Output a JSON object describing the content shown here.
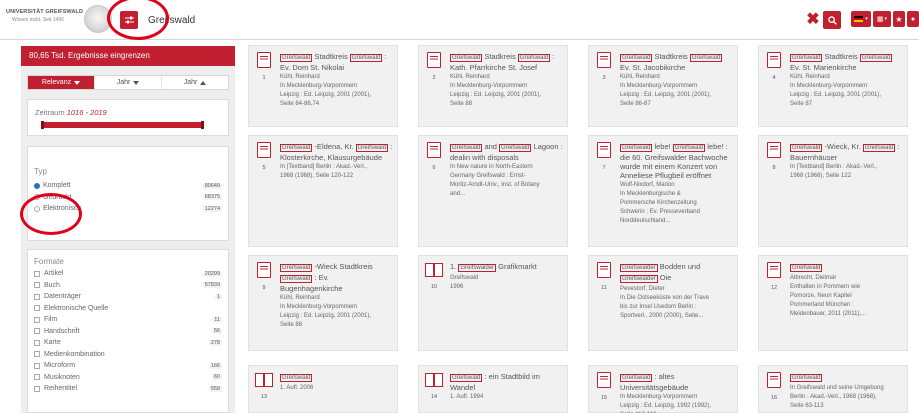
{
  "header": {
    "logo_name": "UNIVERSITÄT GREIFSWALD",
    "logo_claim": "Wissen lockt. Seit 1456",
    "search_value": "Greifswald",
    "clear_symbol": "✖",
    "buttons": {
      "filter_icon": "sliders-icon",
      "search_icon": "search-icon",
      "language_icon": "german-flag-icon",
      "apps_icon": "grid-icon",
      "favorites_icon": "star-icon",
      "account_icon": "user-icon"
    },
    "accent_color": "#c0202f"
  },
  "sidebar": {
    "results_heading": "80,65 Tsd. Ergebnisse eingrenzen",
    "sort_tabs": [
      "Relevanz",
      "Jahr",
      "Jahr"
    ],
    "zeitraum": {
      "label": "Zeitraum",
      "from": "1016",
      "to": "2019",
      "sep": " - "
    },
    "typ": {
      "title": "Typ",
      "options": [
        {
          "label": "Komplett",
          "count": "80649",
          "selected": true
        },
        {
          "label": "Gedruckt",
          "count": "68375",
          "selected": false
        },
        {
          "label": "Elektronisch",
          "count": "12274",
          "selected": false
        }
      ]
    },
    "formate": {
      "title": "Formate",
      "items": [
        {
          "label": "Artikel",
          "count": "20299"
        },
        {
          "label": "Buch",
          "count": "57839"
        },
        {
          "label": "Datenträger",
          "count": "1"
        },
        {
          "label": "Elektronische Quelle",
          "count": ""
        },
        {
          "label": "Film",
          "count": "11"
        },
        {
          "label": "Handschrift",
          "count": "56"
        },
        {
          "label": "Karte",
          "count": "278"
        },
        {
          "label": "Medienkombination",
          "count": ""
        },
        {
          "label": "Microform",
          "count": "166"
        },
        {
          "label": "Musiknoten",
          "count": "60"
        },
        {
          "label": "Reihentitel",
          "count": "559"
        }
      ]
    }
  },
  "results": [
    {
      "num": "1",
      "icon": "document",
      "title_hl": "Greifswald",
      "title": "Stadtkreis",
      "title_hl2": "Greifswald",
      "title_rest": ": Ev. Dom St. Nikolai",
      "lines": [
        "Kühl, Reinhard",
        "In Mecklenburg-Vorpommern",
        "Leipzig : Ed. Leipzig, 2001 (2001),",
        "Seite 84-86,74"
      ]
    },
    {
      "num": "2",
      "icon": "document",
      "title_hl": "Greifswald",
      "title": "Stadkreis",
      "title_hl2": "Greifswald",
      "title_rest": ": Kath. Pfarrkirche St. Josef",
      "lines": [
        "Kühl, Reinhard",
        "In Mecklenburg-Vorpommern",
        "Leipzig : Ed. Leipzig, 2001 (2001),",
        "Seite 88"
      ]
    },
    {
      "num": "3",
      "icon": "document",
      "title_hl": "Greifswald",
      "title": "Stadtkreis",
      "title_hl2": "Greifswald",
      "title_rest": "Ev. St. Jacobikirche",
      "lines": [
        "Kühl, Reinhard",
        "In Mecklenburg-Vorpommern",
        "Leipzig : Ed. Leipzig, 2001 (2001),",
        "Seite 86-87"
      ]
    },
    {
      "num": "4",
      "icon": "document",
      "title_hl": "Greifswald",
      "title": "Stadtkreis",
      "title_hl2": "Greifswald",
      "title_rest": "Ev. St. Marienkirche",
      "lines": [
        "Kühl, Reinhard",
        "In Mecklenburg-Vorpommern",
        "Leipzig : Ed. Leipzig, 2001 (2001),",
        "Seite 87"
      ]
    },
    {
      "num": "5",
      "icon": "document",
      "title_hl": "Greifswald",
      "title": "-Eldena, Kr.",
      "title_hl2": "Greifswald",
      "title_rest": ": Klosterkirche, Klausurgebäude",
      "lines": [
        "In [Textband] Berlin : Akad.-Verl.,",
        "1968 (1968), Seite 120-122"
      ]
    },
    {
      "num": "6",
      "icon": "document",
      "title_hl": "Greifswald",
      "title": "and",
      "title_hl2": "Greifswald",
      "title_rest": "Lagoon : dealin with disposals",
      "lines": [
        "In New nature in North-Eastern",
        "Germany Greifswald : Ernst-",
        "Moritz-Arndt-Univ., Inst. of Botany",
        "and..."
      ]
    },
    {
      "num": "7",
      "icon": "document",
      "title_hl": "Greifswald",
      "title": "lebe!",
      "title_hl2": "Greifswald",
      "title_rest": "lebe! : die 60. Greifswalder Bachwoche wurde mit einem Konzert von Anneliese Pflugbeil eröffnet",
      "lines": [
        "Wulf-Nixdorf, Marion",
        "In Mecklenburgische &",
        "Pommersche Kirchenzeitung",
        "Schwerin : Ev. Presseverband",
        "Norddeutschland..."
      ]
    },
    {
      "num": "8",
      "icon": "document",
      "title_hl": "Greifswald",
      "title": "-Wieck, Kr.",
      "title_hl2": "Greifswald",
      "title_rest": ": Bauernhäuser",
      "lines": [
        "In [Textband] Berlin : Akad.-Verl.,",
        "1968 (1968), Seite 122"
      ]
    },
    {
      "num": "9",
      "icon": "document",
      "title_hl": "Greifswald",
      "title": "-Wieck Stadtkreis",
      "title_hl2": "Greifswald",
      "title_rest": ": Ev. Bugenhagenkirche",
      "lines": [
        "Kühl, Reinhard",
        "In Mecklenburg-Vorpommern",
        "Leipzig : Ed. Leipzig, 2001 (2001),",
        "Seite 88"
      ]
    },
    {
      "num": "10",
      "icon": "book",
      "title_hl": "",
      "title": "1.",
      "title_hl2": "Greifswalder",
      "title_rest": "Grafikmarkt",
      "lines": [
        "Greifswald",
        "1996"
      ]
    },
    {
      "num": "11",
      "icon": "document",
      "title_hl": "Greifswalder",
      "title": "Bodden und",
      "title_hl2": "Greifswalder",
      "title_rest": "Oie",
      "lines": [
        "Pevestorf, Dieter",
        "In Die Ostseeküste von der Trave",
        "bis zur Insel Usedom Berlin :",
        "Sportverl., 2000 (2000), Seite..."
      ]
    },
    {
      "num": "12",
      "icon": "document",
      "title_hl": "Greifswald",
      "title": "",
      "title_hl2": "",
      "title_rest": "",
      "lines": [
        "Albrecht, Dietmar",
        "Enthalten in Pommern wie",
        "Pomorze, Neun Kapitel",
        "Pommerland München :",
        "Meidenbauer, 2011 (2011),..."
      ]
    },
    {
      "num": "13",
      "icon": "book",
      "title_hl": "Greifswald",
      "title": "",
      "title_hl2": "",
      "title_rest": "",
      "lines": [
        "1. Aufl. 2006"
      ]
    },
    {
      "num": "14",
      "icon": "book",
      "title_hl": "Greifswald",
      "title": ": ein Stadtbild im Wandel",
      "title_hl2": "",
      "title_rest": "",
      "lines": [
        "1. Aufl. 1994"
      ]
    },
    {
      "num": "15",
      "icon": "document",
      "title_hl": "Greifswald",
      "title": ": altes Universitätsgebäude",
      "title_hl2": "",
      "title_rest": "",
      "lines": [
        "In Mecklenburg-Vorpommern",
        "Leipzig : Ed. Leipzig, 1992 (1992),",
        "Seite 112-113"
      ]
    },
    {
      "num": "16",
      "icon": "document",
      "title_hl": "Greifswald",
      "title": "",
      "title_hl2": "",
      "title_rest": "",
      "lines": [
        "In Greifswald und seine Umgebung",
        "Berlin : Akad.-Verl., 1968 (1968),",
        "Seite 63-113"
      ]
    }
  ]
}
